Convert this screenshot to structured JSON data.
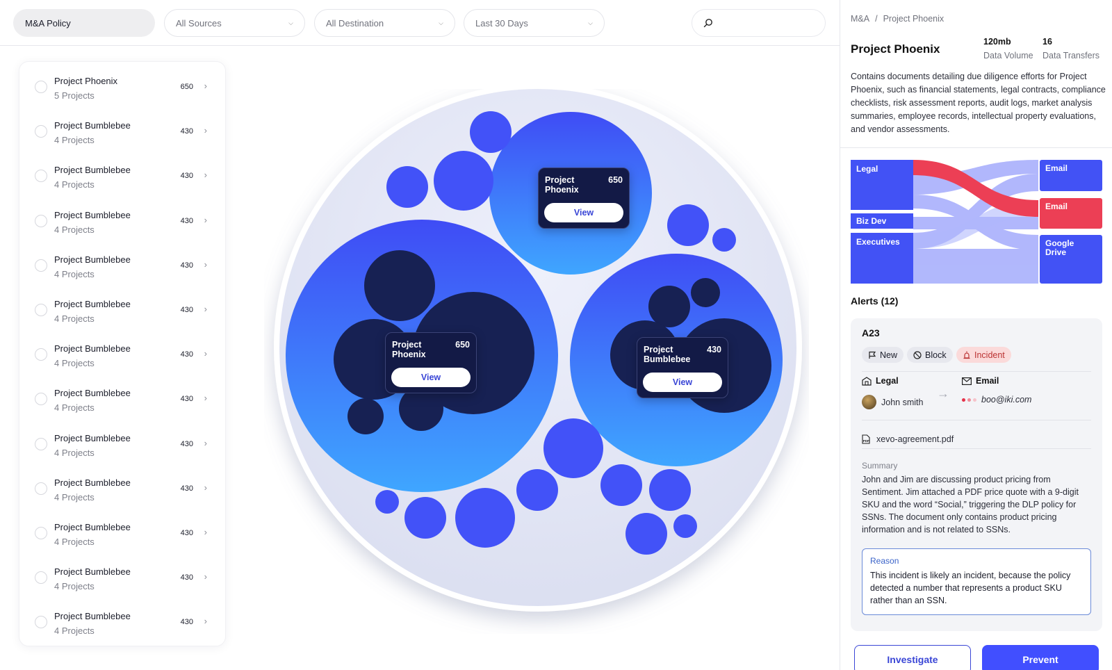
{
  "filters": {
    "policy": "M&A Policy",
    "sources": "All Sources",
    "destination": "All Destination",
    "range": "Last 30 Days",
    "search_placeholder": ""
  },
  "list": [
    {
      "name": "Project Phoenix",
      "sub": "5 Projects",
      "count": "650"
    },
    {
      "name": "Project Bumblebee",
      "sub": "4 Projects",
      "count": "430"
    },
    {
      "name": "Project Bumblebee",
      "sub": "4 Projects",
      "count": "430"
    },
    {
      "name": "Project Bumblebee",
      "sub": "4 Projects",
      "count": "430"
    },
    {
      "name": "Project Bumblebee",
      "sub": "4 Projects",
      "count": "430"
    },
    {
      "name": "Project Bumblebee",
      "sub": "4 Projects",
      "count": "430"
    },
    {
      "name": "Project Bumblebee",
      "sub": "4 Projects",
      "count": "430"
    },
    {
      "name": "Project Bumblebee",
      "sub": "4 Projects",
      "count": "430"
    },
    {
      "name": "Project Bumblebee",
      "sub": "4 Projects",
      "count": "430"
    },
    {
      "name": "Project Bumblebee",
      "sub": "4 Projects",
      "count": "430"
    },
    {
      "name": "Project Bumblebee",
      "sub": "4 Projects",
      "count": "430"
    },
    {
      "name": "Project Bumblebee",
      "sub": "4 Projects",
      "count": "430"
    },
    {
      "name": "Project Bumblebee",
      "sub": "4 Projects",
      "count": "430"
    }
  ],
  "bubbles": {
    "tooltips": [
      {
        "name": "Project Phoenix",
        "value": "650",
        "button": "View"
      },
      {
        "name": "Project Phoenix",
        "value": "650",
        "button": "View"
      },
      {
        "name": "Project Bumblebee",
        "value": "430",
        "button": "View"
      }
    ]
  },
  "panel": {
    "breadcrumb": [
      "M&A",
      "Project Phoenix"
    ],
    "title": "Project Phoenix",
    "stats": [
      {
        "value": "120mb",
        "label": "Data Volume"
      },
      {
        "value": "16",
        "label": "Data Transfers"
      }
    ],
    "description": "Contains documents detailing due diligence efforts for Project Phoenix, such as financial statements, legal contracts, compliance checklists, risk assessment reports, audit logs, market analysis summaries, employee records, intellectual property evaluations, and vendor assessments.",
    "sankey": {
      "sources": [
        "Legal",
        "Biz Dev",
        "Executives"
      ],
      "destinations": [
        "Email",
        "Email",
        "Google Drive"
      ],
      "colors": {
        "blue": "#4252f5",
        "red": "#ec3f55",
        "flow": "#9ea6fb"
      }
    },
    "alerts_title": "Alerts (12)",
    "alert": {
      "id": "A23",
      "tags": [
        "New",
        "Block",
        "Incident"
      ],
      "from_label": "Legal",
      "from_user": "John smith",
      "to_label": "Email",
      "to_addr": "boo@iki.com",
      "file": "xevo-agreement.pdf",
      "summary_label": "Summary",
      "summary": "John and Jim are discussing product pricing from Sentiment. Jim attached a PDF price quote with a 9-digit SKU and the word “Social,” triggering the DLP policy for SSNs. The document only contains product pricing information and is not related to SSNs.",
      "reason_label": "Reason",
      "reason": "This incident is likely an incident, because the policy detected a number that represents a product SKU rather than an SSN."
    },
    "actions": {
      "investigate": "Investigate",
      "prevent": "Prevent"
    }
  }
}
